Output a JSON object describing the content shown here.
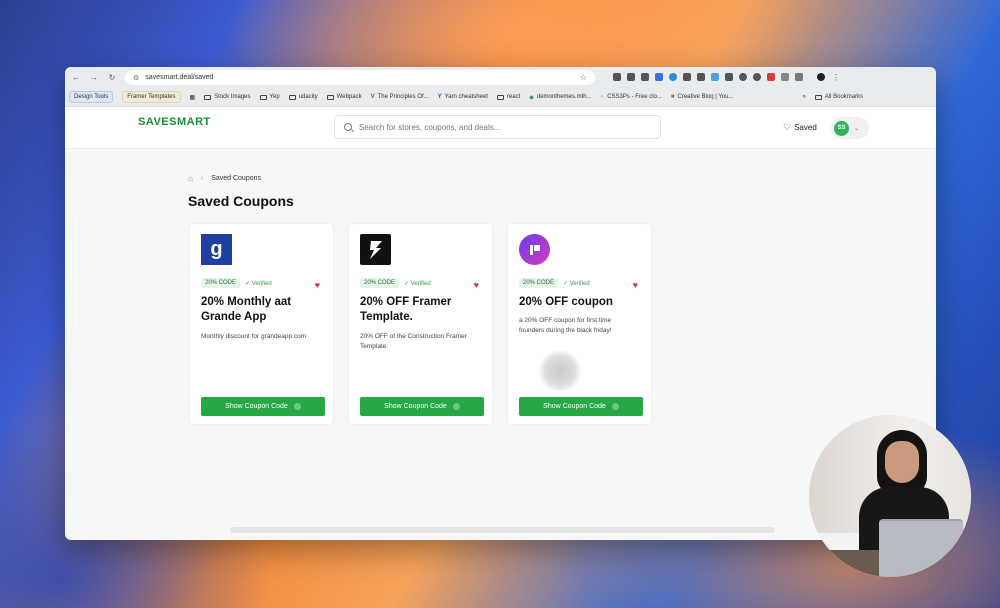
{
  "browser": {
    "url": "savesmart.deal/saved",
    "bookmarks": [
      {
        "label": "Design Tools",
        "type": "chip"
      },
      {
        "label": "Framer Templates",
        "type": "chip"
      },
      {
        "label": "Stock Images",
        "type": "folder"
      },
      {
        "label": "Yep",
        "type": "folder"
      },
      {
        "label": "udacity",
        "type": "folder"
      },
      {
        "label": "Webpack",
        "type": "folder"
      },
      {
        "label": "The Principles Of...",
        "type": "link"
      },
      {
        "label": "Yarn cheatsheet",
        "type": "link"
      },
      {
        "label": "react",
        "type": "folder"
      },
      {
        "label": "demonthemes.mth...",
        "type": "link"
      },
      {
        "label": "CSS3Ps - Free clo...",
        "type": "link"
      },
      {
        "label": "Creative Bloq | You...",
        "type": "link"
      }
    ],
    "overflow_label": "»",
    "all_bookmarks": "All Bookmarks"
  },
  "header": {
    "logo": "SAVESMART",
    "search_placeholder": "Search for stores, coupons, and deals...",
    "saved_label": "Saved",
    "avatar_initials": "SS"
  },
  "breadcrumb": {
    "current": "Saved Coupons"
  },
  "page_title": "Saved Coupons",
  "coupons": [
    {
      "logo_text": "g",
      "badge": "20% CODE",
      "verified": "✓ Verified",
      "title": "20% Monthly aat Grande App",
      "description": "Monthly discount for grandeapp.com",
      "button": "Show Coupon Code"
    },
    {
      "logo_text": "",
      "badge": "20% CODE",
      "verified": "✓ Verified",
      "title": "20% OFF Framer Template.",
      "description": "20% OFF of the Construction Framer Template.",
      "button": "Show Coupon Code"
    },
    {
      "logo_text": "",
      "badge": "20% CODE",
      "verified": "✓ Verified",
      "title": "20% OFF coupon",
      "description": "a 20% OFF coupon for first time founders during the black friday!",
      "button": "Show Coupon Code"
    }
  ],
  "colors": {
    "brand": "#1d8a3a",
    "button": "#25a845",
    "heart": "#d8334a"
  }
}
